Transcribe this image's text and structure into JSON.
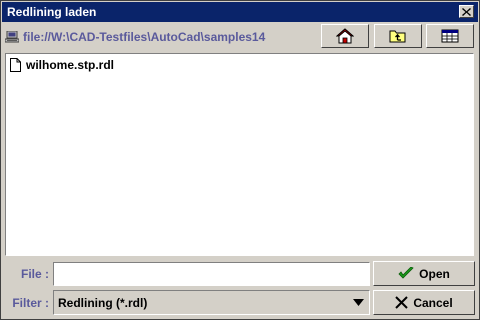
{
  "window": {
    "title": "Redlining laden"
  },
  "path": {
    "text": "file://W:\\CAD-Testfiles\\AutoCad\\samples14"
  },
  "toolbar": {
    "home_icon": "home-icon",
    "up_folder_icon": "up-folder-icon",
    "details_view_icon": "details-view-icon"
  },
  "files": [
    {
      "name": "wilhome.stp.rdl",
      "icon": "document-icon"
    }
  ],
  "file_field": {
    "label": "File :",
    "value": ""
  },
  "filter": {
    "label": "Filter :",
    "selected": "Redlining (*.rdl)"
  },
  "buttons": {
    "open_label": "Open",
    "cancel_label": "Cancel"
  },
  "colors": {
    "title_bar": "#0a246a",
    "label_text": "#5a5a9c",
    "open_check": "#1a9a1a"
  }
}
